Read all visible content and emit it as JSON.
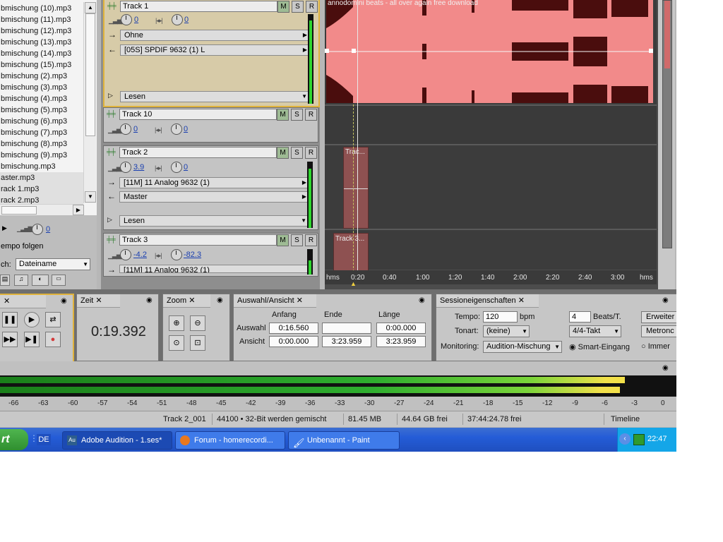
{
  "files": [
    "bmischung (10).mp3",
    "bmischung (11).mp3",
    "bmischung (12).mp3",
    "bmischung (13).mp3",
    "bmischung (14).mp3",
    "bmischung (15).mp3",
    "bmischung (2).mp3",
    "bmischung (3).mp3",
    "bmischung (4).mp3",
    "bmischung (5).mp3",
    "bmischung (6).mp3",
    "bmischung (7).mp3",
    "bmischung (8).mp3",
    "bmischung (9).mp3",
    "bmischung.mp3",
    "aster.mp3",
    "rack 1.mp3",
    "rack 2.mp3"
  ],
  "file_options": {
    "volume_value": "0",
    "tempo_follow": "empo folgen",
    "sort_label": "ch:",
    "sort_value": "Dateiname"
  },
  "tracks": [
    {
      "name": "Track 1",
      "m": "M",
      "s": "S",
      "r": "R",
      "vol": "0",
      "pan": "0",
      "input": "Ohne",
      "output": "[05S] SPDIF 9632 (1) L",
      "mode": "Lesen"
    },
    {
      "name": "Track 10",
      "m": "M",
      "s": "S",
      "r": "R",
      "vol": "0",
      "pan": "0"
    },
    {
      "name": "Track 2",
      "m": "M",
      "s": "S",
      "r": "R",
      "vol": "3.9",
      "pan": "0",
      "input": "[11M] 11 Analog 9632 (1)",
      "output": "Master",
      "mode": "Lesen"
    },
    {
      "name": "Track 3",
      "m": "M",
      "s": "S",
      "r": "R",
      "vol": "-4.2",
      "pan": "-82.3",
      "input": "[11M] 11 Analog 9632 (1)"
    }
  ],
  "waveform": {
    "clip1_label": "annodomini beats - all over again free download",
    "clip2_label": "Trac...",
    "clip3_label": "Track 3..."
  },
  "ruler": {
    "left_unit": "hms",
    "right_unit": "hms",
    "ticks": [
      "0:20",
      "0:40",
      "1:00",
      "1:20",
      "1:40",
      "2:00",
      "2:20",
      "2:40",
      "3:00"
    ]
  },
  "time_panel": {
    "tab": "Zeit",
    "value": "0:19.392"
  },
  "zoom_panel": {
    "tab": "Zoom"
  },
  "selection_panel": {
    "tab": "Auswahl/Ansicht",
    "col_start": "Anfang",
    "col_end": "Ende",
    "col_length": "Länge",
    "row_selection": "Auswahl",
    "row_view": "Ansicht",
    "sel_start": "0:16.560",
    "sel_end": "",
    "sel_length": "0:00.000",
    "view_start": "0:00.000",
    "view_end": "3:23.959",
    "view_length": "3:23.959"
  },
  "session_panel": {
    "tab": "Sessioneigenschaften",
    "tempo_label": "Tempo:",
    "tempo_value": "120",
    "tempo_unit": "bpm",
    "beats_value": "4",
    "beats_unit": "Beats/T.",
    "key_label": "Tonart:",
    "key_value": "(keine)",
    "meter_value": "4/4-Takt",
    "monitoring_label": "Monitoring:",
    "monitoring_value": "Audition-Mischung",
    "radio1": "Smart-Eingang",
    "radio2": "Immer",
    "btn1": "Erweiter",
    "btn2": "Metronc"
  },
  "level_ticks": [
    "-66",
    "-63",
    "-60",
    "-57",
    "-54",
    "-51",
    "-48",
    "-45",
    "-42",
    "-39",
    "-36",
    "-33",
    "-30",
    "-27",
    "-24",
    "-21",
    "-18",
    "-15",
    "-12",
    "-9",
    "-6",
    "-3",
    "0"
  ],
  "status": {
    "track": "Track 2_001",
    "format": "44100 • 32-Bit werden gemischt",
    "size": "81.45 MB",
    "free": "44.64 GB frei",
    "time_free": "37:44:24.78 frei",
    "mode": "Timeline"
  },
  "taskbar": {
    "start": "rt",
    "lang": "DE",
    "tasks": [
      "Adobe Audition - 1.ses*",
      "Forum - homerecordi...",
      "Unbenannt - Paint"
    ],
    "clock": "22:47"
  }
}
